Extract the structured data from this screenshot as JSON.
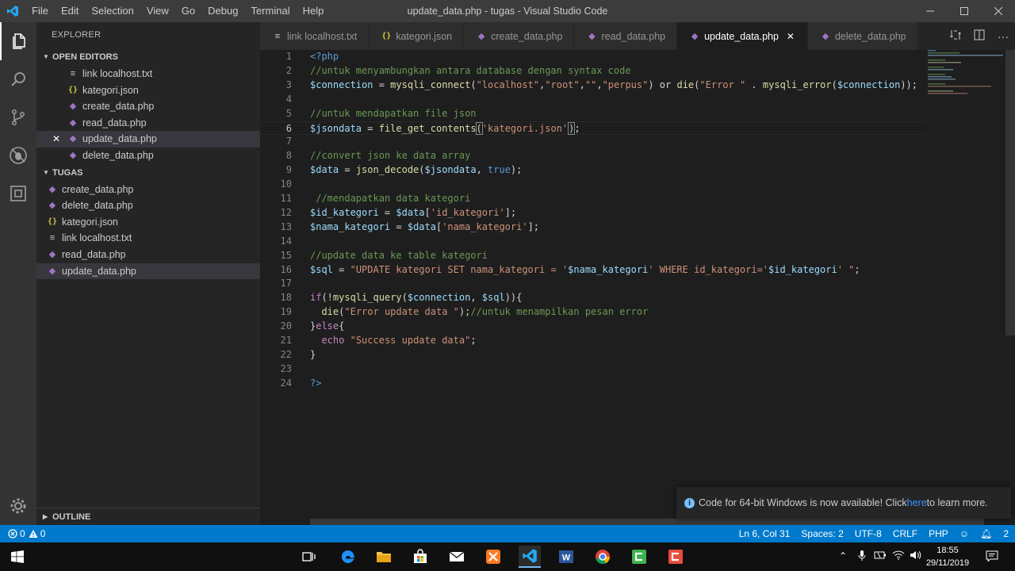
{
  "window": {
    "title": "update_data.php - tugas - Visual Studio Code",
    "menu": [
      "File",
      "Edit",
      "Selection",
      "View",
      "Go",
      "Debug",
      "Terminal",
      "Help"
    ]
  },
  "sidebar": {
    "title": "EXPLORER",
    "open_editors_label": "OPEN EDITORS",
    "open_editors": [
      {
        "name": "link localhost.txt",
        "type": "txt"
      },
      {
        "name": "kategori.json",
        "type": "json"
      },
      {
        "name": "create_data.php",
        "type": "php"
      },
      {
        "name": "read_data.php",
        "type": "php"
      },
      {
        "name": "update_data.php",
        "type": "php",
        "active": true
      },
      {
        "name": "delete_data.php",
        "type": "php"
      }
    ],
    "folder_label": "TUGAS",
    "files": [
      {
        "name": "create_data.php",
        "type": "php"
      },
      {
        "name": "delete_data.php",
        "type": "php"
      },
      {
        "name": "kategori.json",
        "type": "json"
      },
      {
        "name": "link localhost.txt",
        "type": "txt"
      },
      {
        "name": "read_data.php",
        "type": "php"
      },
      {
        "name": "update_data.php",
        "type": "php",
        "selected": true
      }
    ],
    "outline_label": "OUTLINE"
  },
  "tabs": [
    {
      "label": "link localhost.txt",
      "type": "txt"
    },
    {
      "label": "kategori.json",
      "type": "json"
    },
    {
      "label": "create_data.php",
      "type": "php"
    },
    {
      "label": "read_data.php",
      "type": "php"
    },
    {
      "label": "update_data.php",
      "type": "php",
      "active": true
    },
    {
      "label": "delete_data.php",
      "type": "php"
    }
  ],
  "editor": {
    "current_line": 6,
    "lines": [
      "1",
      "2",
      "3",
      "4",
      "5",
      "6",
      "7",
      "8",
      "9",
      "10",
      "11",
      "12",
      "13",
      "14",
      "15",
      "16",
      "17",
      "18",
      "19",
      "20",
      "21",
      "22",
      "23",
      "24"
    ]
  },
  "notification": {
    "text_before": "Code for 64-bit Windows is now available! Click ",
    "link": "here",
    "text_after": " to learn more."
  },
  "statusbar": {
    "errors": "0",
    "warnings": "0",
    "position": "Ln 6, Col 31",
    "spaces": "Spaces: 2",
    "encoding": "UTF-8",
    "eol": "CRLF",
    "language": "PHP",
    "notifications": "2"
  },
  "taskbar": {
    "time": "18:55",
    "date": "29/11/2019"
  },
  "colors": {
    "accent": "#007acc",
    "titlebar": "#3c3c3c",
    "editor_bg": "#1e1e1e"
  }
}
